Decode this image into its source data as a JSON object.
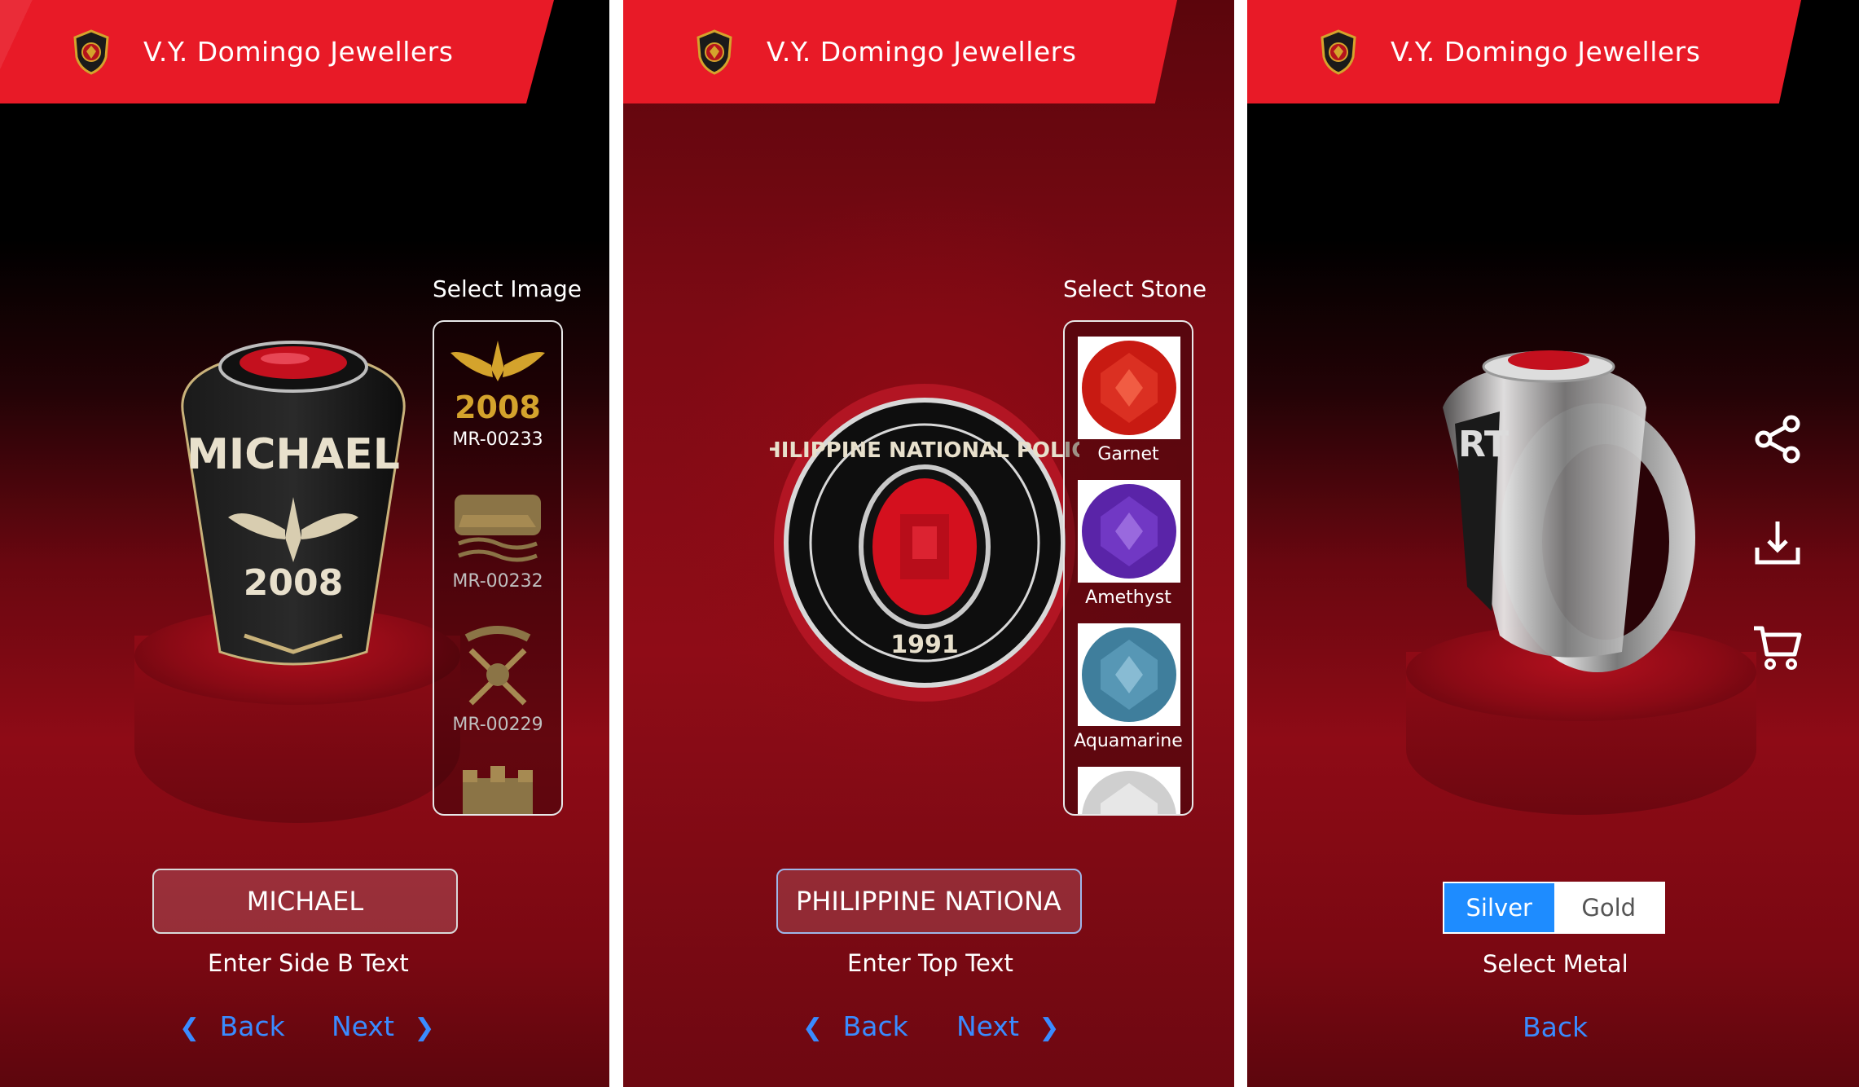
{
  "app": {
    "title": "V.Y. Domingo Jewellers"
  },
  "screens": [
    {
      "engraving_text": "MICHAEL",
      "engraving_year": "2008",
      "picker_title": "Select Image",
      "images": [
        {
          "code": "MR-00233",
          "selected": true
        },
        {
          "code": "MR-00232",
          "selected": false
        },
        {
          "code": "MR-00229",
          "selected": false
        }
      ],
      "input_value": "MICHAEL",
      "input_caption": "Enter Side B Text",
      "back_label": "Back",
      "next_label": "Next",
      "colors": {
        "accent": "#3a8bff",
        "brand": "#e81a27",
        "stone": "#c4101e"
      }
    },
    {
      "ring_top_text": "PHILIPPINE NATIONAL POLICE",
      "ring_year": "1991",
      "picker_title": "Select Stone",
      "stones": [
        {
          "name": "Garnet",
          "color": "#c81a12"
        },
        {
          "name": "Amethyst",
          "color": "#6a2fb8"
        },
        {
          "name": "Aquamarine",
          "color": "#4a90b0"
        },
        {
          "name": "",
          "color": "#d8d8d8"
        }
      ],
      "input_value": "PHILIPPINE NATIONA",
      "input_caption": "Enter Top Text",
      "back_label": "Back",
      "next_label": "Next"
    },
    {
      "ring_side_text": "RT",
      "metal_options": [
        "Silver",
        "Gold"
      ],
      "selected_metal": "Silver",
      "metal_caption": "Select Metal",
      "back_label": "Back",
      "actions": [
        {
          "icon": "share-icon"
        },
        {
          "icon": "download-icon"
        },
        {
          "icon": "cart-icon"
        }
      ]
    }
  ]
}
